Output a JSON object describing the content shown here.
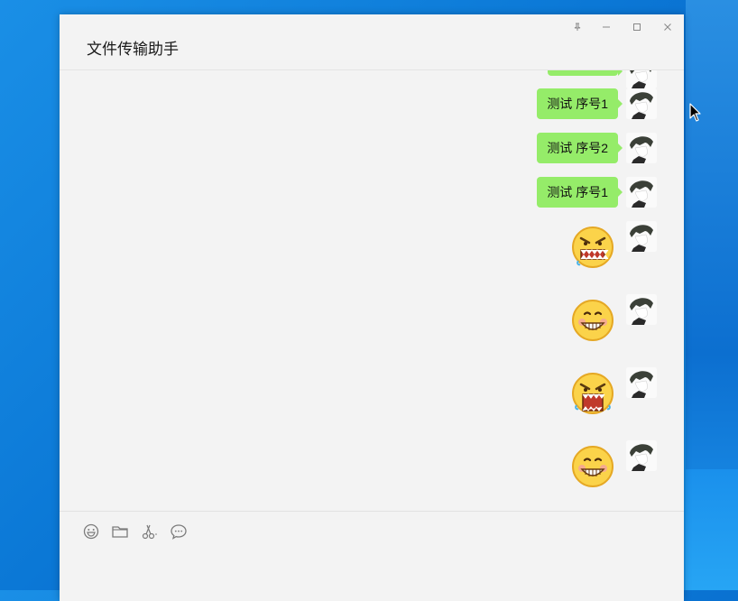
{
  "window": {
    "title": "文件传输助手",
    "controls": [
      "pin-icon",
      "minimize-icon",
      "maximize-icon",
      "close-icon"
    ]
  },
  "messages": [
    {
      "type": "text",
      "text": "",
      "partial": true
    },
    {
      "type": "text",
      "text": "测试 序号1"
    },
    {
      "type": "text",
      "text": "测试 序号2"
    },
    {
      "type": "text",
      "text": "测试 序号1"
    },
    {
      "type": "sticker",
      "sticker": "angry-face"
    },
    {
      "type": "sticker",
      "sticker": "grin-face"
    },
    {
      "type": "sticker",
      "sticker": "angry-face"
    },
    {
      "type": "sticker",
      "sticker": "grin-face"
    }
  ],
  "toolbar": {
    "icons": [
      "emoji-icon",
      "folder-icon",
      "scissors-icon",
      "chat-history-icon"
    ]
  },
  "colors": {
    "bubble": "#95ec69",
    "window_bg": "#f3f3f3",
    "desktop": "#0b78d6"
  }
}
